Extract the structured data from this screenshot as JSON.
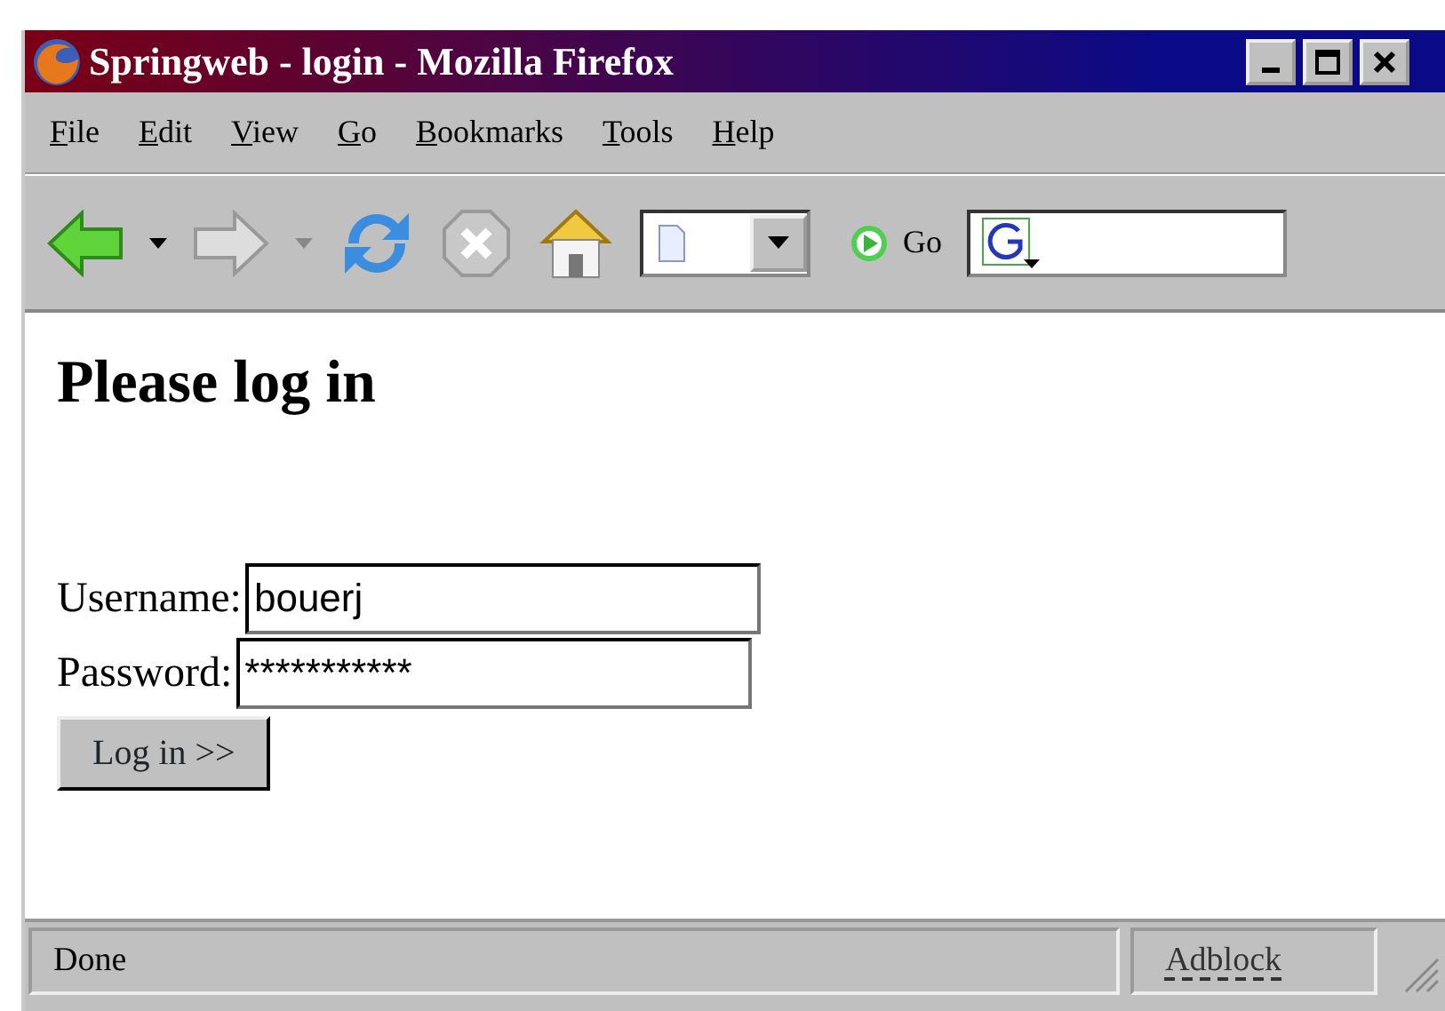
{
  "window": {
    "title": "Springweb - login - Mozilla Firefox"
  },
  "menu": [
    "File",
    "Edit",
    "View",
    "Go",
    "Bookmarks",
    "Tools",
    "Help"
  ],
  "toolbar": {
    "go_label": "Go"
  },
  "page": {
    "heading": "Please log in",
    "fields": [
      {
        "label": "Username:",
        "value": "bouerj"
      },
      {
        "label": "Password:",
        "value": "***********"
      }
    ],
    "submit": "Log in >>"
  },
  "status_bar": {
    "text": "Done",
    "panel": "Adblock"
  }
}
